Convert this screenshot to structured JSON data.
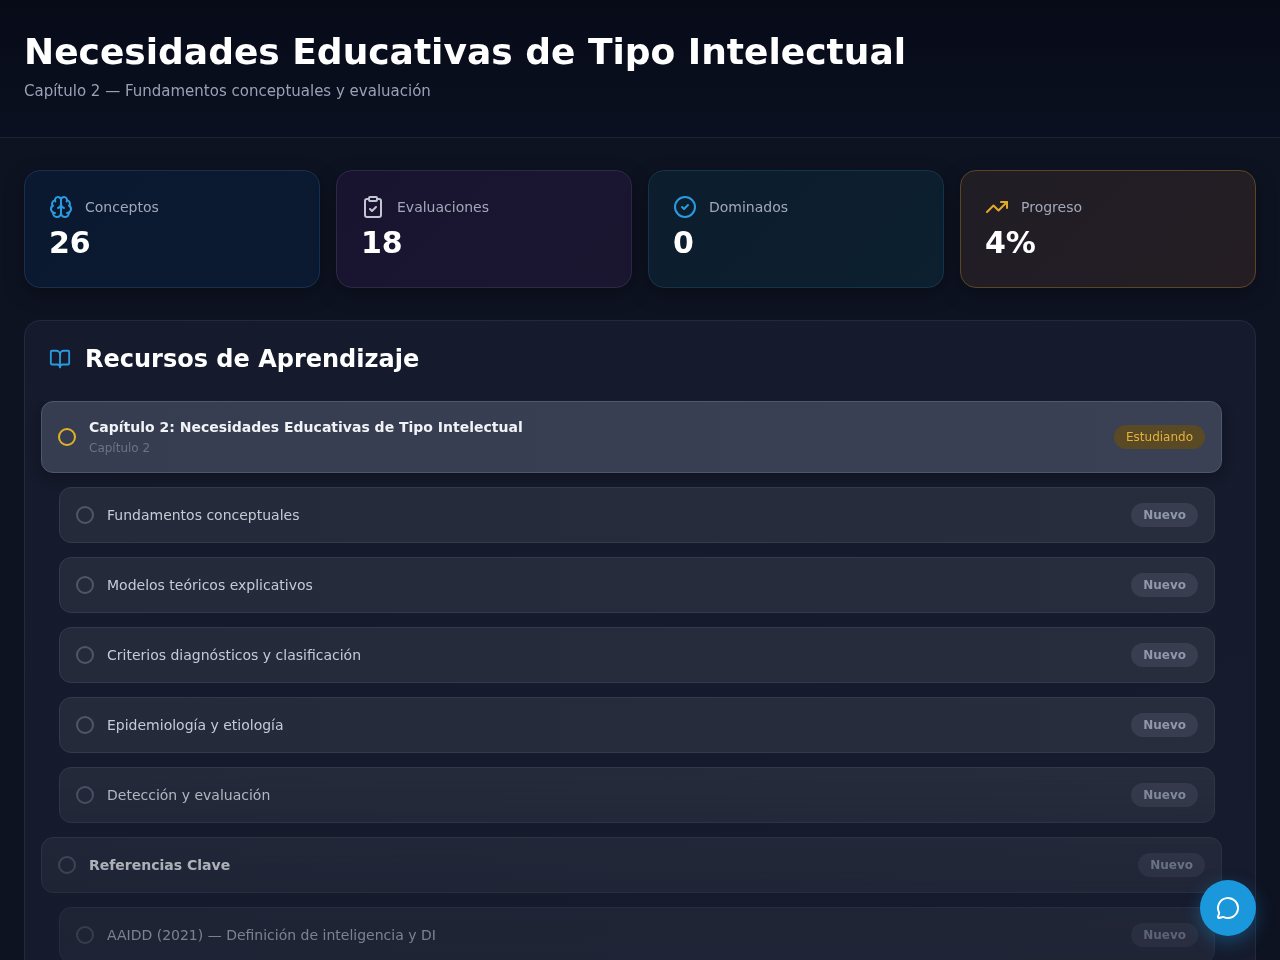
{
  "header": {
    "title": "Necesidades Educativas de Tipo Intelectual",
    "subtitle": "Capítulo 2 — Fundamentos conceptuales y evaluación"
  },
  "stats": [
    {
      "kind": "brain",
      "label": "Conceptos",
      "value": "26",
      "color": "#2a9be0"
    },
    {
      "kind": "clipboard",
      "label": "Evaluaciones",
      "value": "18",
      "color": "#c2c6d2"
    },
    {
      "kind": "check",
      "label": "Dominados",
      "value": "0",
      "color": "#2a9be0"
    },
    {
      "kind": "trend",
      "label": "Progreso",
      "value": "4%",
      "color": "#e2a92c"
    }
  ],
  "resources": {
    "title": "Recursos de Aprendizaje",
    "sections": [
      {
        "title": "Capítulo 2: Necesidades Educativas de Tipo Intelectual",
        "subtitle": "Capítulo 2",
        "status": "Estudiando",
        "kind": "studying",
        "selected": true,
        "children": [
          {
            "title": "Fundamentos conceptuales",
            "status": "Nuevo",
            "kind": "new",
            "selected": false
          },
          {
            "title": "Modelos teóricos explicativos",
            "status": "Nuevo",
            "kind": "new",
            "selected": false
          },
          {
            "title": "Criterios diagnósticos y clasificación",
            "status": "Nuevo",
            "kind": "new",
            "selected": false
          },
          {
            "title": "Epidemiología y etiología",
            "status": "Nuevo",
            "kind": "new",
            "selected": false
          },
          {
            "title": "Detección y evaluación",
            "status": "Nuevo",
            "kind": "new",
            "selected": false
          }
        ]
      },
      {
        "title": "Referencias Clave",
        "status": "Nuevo",
        "kind": "new",
        "selected": false,
        "children": [
          {
            "title": "AAIDD (2021) — Definición de inteligencia y DI",
            "status": "Nuevo",
            "kind": "new",
            "selected": false
          }
        ]
      }
    ]
  }
}
